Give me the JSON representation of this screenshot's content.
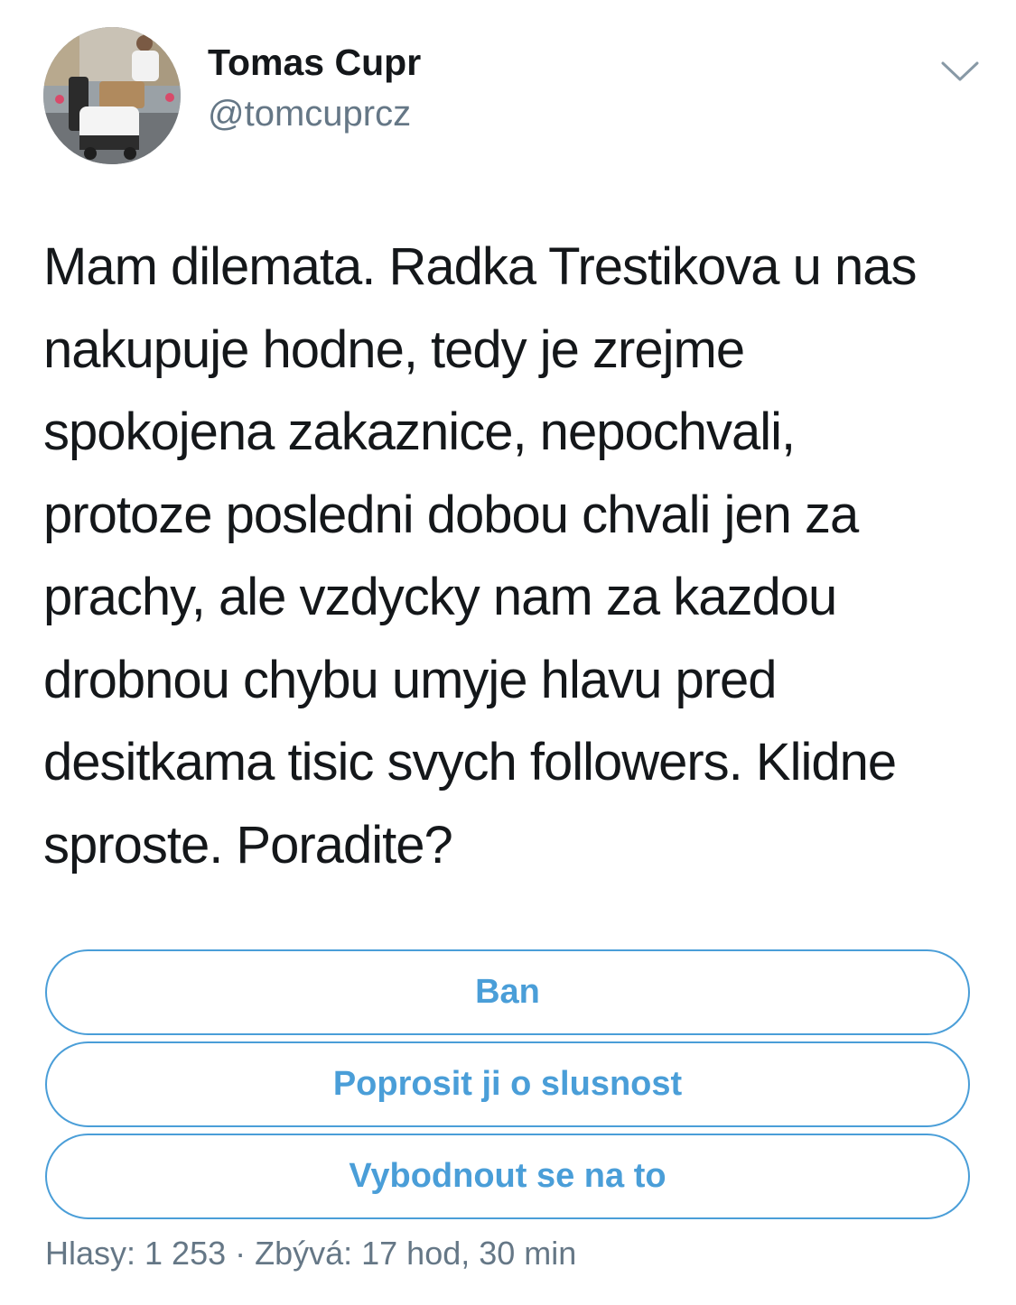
{
  "author": {
    "name": "Tomas Cupr",
    "handle": "@tomcuprcz",
    "avatar_icon": "profile-photo"
  },
  "menu": {
    "icon": "chevron-down-icon"
  },
  "tweet": {
    "text_lines": [
      "Mam dilemata. Radka Trestikova u nas",
      "nakupuje hodne, tedy je zrejme",
      "spokojena zakaznice, nepochvali,",
      "protoze posledni dobou chvali jen za",
      "prachy, ale vzdycky nam za kazdou",
      "drobnou chybu umyje hlavu pred",
      "desitkama tisic svych followers. Klidne",
      "sproste. Poradite?"
    ]
  },
  "poll": {
    "options": [
      {
        "label": "Ban"
      },
      {
        "label": "Poprosit ji o slusnost"
      },
      {
        "label": "Vybodnout se na to"
      }
    ],
    "meta": "Hlasy: 1 253 · Zbývá: 17 hod, 30 min"
  },
  "colors": {
    "accent": "#4a9ed8",
    "text": "#14171a",
    "secondary_text": "#657786"
  }
}
